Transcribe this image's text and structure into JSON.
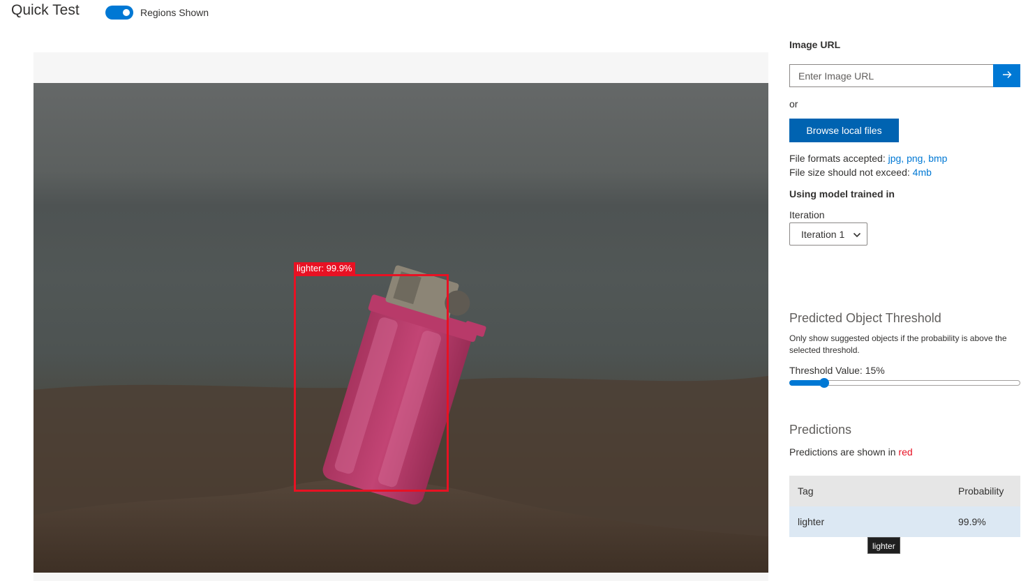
{
  "header": {
    "title": "Quick Test",
    "regions_toggle_label": "Regions Shown",
    "regions_toggle_on": true
  },
  "detection": {
    "label": "lighter: 99.9%",
    "color": "#e81123"
  },
  "sidebar": {
    "image_url_label": "Image URL",
    "image_url_placeholder": "Enter Image URL",
    "image_url_value": "",
    "or_text": "or",
    "browse_button": "Browse local files",
    "formats_prefix": "File formats accepted: ",
    "formats_value": "jpg, png, bmp",
    "size_prefix": "File size should not exceed: ",
    "size_value": "4mb",
    "model_heading": "Using model trained in",
    "iteration_label": "Iteration",
    "iteration_selected": "Iteration 1",
    "threshold_heading": "Predicted Object Threshold",
    "threshold_description": "Only show suggested objects if the probability is above the selected threshold.",
    "threshold_label": "Threshold Value: 15%",
    "threshold_percent": 15,
    "predictions_heading": "Predictions",
    "predictions_note_prefix": "Predictions are shown in ",
    "predictions_note_color": "red"
  },
  "predictions_table": {
    "headers": [
      "Tag",
      "Probability"
    ],
    "rows": [
      {
        "tag": "lighter",
        "probability": "99.9%"
      }
    ]
  },
  "tooltip": "lighter",
  "colors": {
    "accent": "#0078d4",
    "prediction": "#e81123"
  }
}
